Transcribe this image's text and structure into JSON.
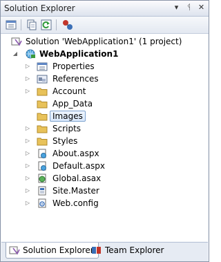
{
  "window": {
    "title": "Solution Explorer",
    "controls": [
      "▾",
      "ᛩ",
      "✕"
    ]
  },
  "toolbar": {
    "buttons": [
      "properties-icon",
      "show-all-files-icon",
      "refresh-icon",
      "view-class-diagram-icon"
    ]
  },
  "tree": {
    "solution": {
      "label": "Solution 'WebApplication1' (1 project)"
    },
    "project": {
      "label": "WebApplication1"
    },
    "items": [
      {
        "label": "Properties",
        "icon": "properties-folder-icon"
      },
      {
        "label": "References",
        "icon": "references-icon"
      },
      {
        "label": "Account",
        "icon": "folder-icon"
      },
      {
        "label": "App_Data",
        "icon": "folder-icon"
      },
      {
        "label": "Images",
        "icon": "folder-icon",
        "selected": true
      },
      {
        "label": "Scripts",
        "icon": "folder-icon"
      },
      {
        "label": "Styles",
        "icon": "folder-icon"
      },
      {
        "label": "About.aspx",
        "icon": "aspx-file-icon"
      },
      {
        "label": "Default.aspx",
        "icon": "aspx-file-icon"
      },
      {
        "label": "Global.asax",
        "icon": "asax-file-icon"
      },
      {
        "label": "Site.Master",
        "icon": "master-file-icon"
      },
      {
        "label": "Web.config",
        "icon": "config-file-icon"
      }
    ]
  },
  "tabs": [
    {
      "label": "Solution Explorer",
      "active": true
    },
    {
      "label": "Team Explorer",
      "active": false
    }
  ],
  "colors": {
    "selection_border": "#7da2ce",
    "folder": "#e8c25a",
    "accent": "#3b6fb6"
  }
}
